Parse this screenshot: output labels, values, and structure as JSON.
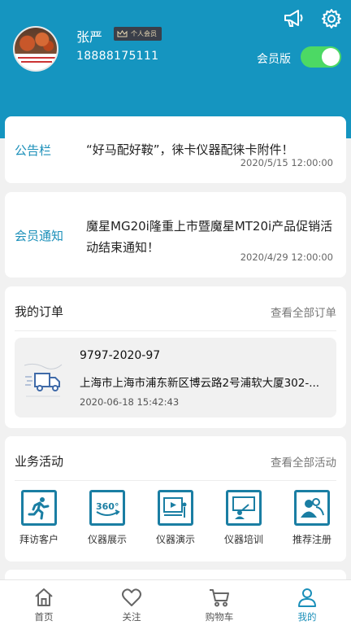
{
  "profile": {
    "name": "张严",
    "badge": "个人会员",
    "phone": "18888175111",
    "member_label": "会员版",
    "member_toggle_on": true
  },
  "notices": [
    {
      "title": "公告栏",
      "text": "“好马配好鞍”，徕卡仪器配徕卡附件！",
      "time": "2020/5/15 12:00:00"
    },
    {
      "title": "会员通知",
      "text": "魔星MG20i隆重上市暨魔星MT20i产品促销活动结束通知！",
      "time": "2020/4/29 12:00:00"
    }
  ],
  "orders": {
    "title": "我的订单",
    "link": "查看全部订单",
    "items": [
      {
        "number": "9797-2020-97",
        "address": "上海市上海市浦东新区博云路2号浦软大厦302-...",
        "time": "2020-06-18 15:42:43"
      }
    ]
  },
  "activities": {
    "title": "业务活动",
    "link": "查看全部活动",
    "items": [
      {
        "label": "拜访客户",
        "icon": "running-person-icon"
      },
      {
        "label": "仪器展示",
        "icon": "360-view-icon"
      },
      {
        "label": "仪器演示",
        "icon": "video-demo-icon"
      },
      {
        "label": "仪器培训",
        "icon": "training-board-icon"
      },
      {
        "label": "推荐注册",
        "icon": "users-icon"
      }
    ]
  },
  "tabbar": {
    "items": [
      {
        "label": "首页",
        "icon": "home-icon",
        "active": false
      },
      {
        "label": "关注",
        "icon": "heart-icon",
        "active": false
      },
      {
        "label": "购物车",
        "icon": "cart-icon",
        "active": false
      },
      {
        "label": "我的",
        "icon": "user-icon",
        "active": true
      }
    ]
  },
  "colors": {
    "header": "#1595c0",
    "accent": "#1a8fb9",
    "toggle": "#4cd964",
    "icon_border": "#1a7ea3"
  }
}
